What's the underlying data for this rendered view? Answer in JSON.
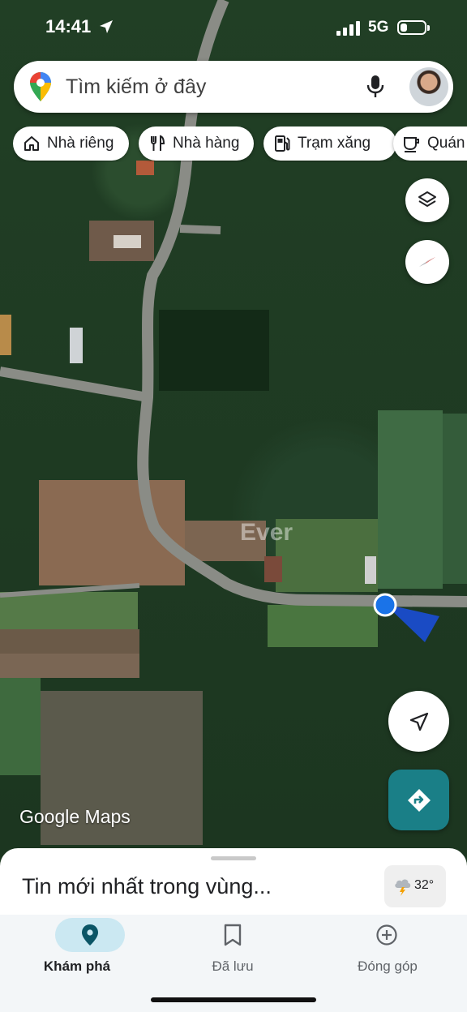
{
  "status_bar": {
    "time": "14:41",
    "network": "5G",
    "battery_level": 0.3
  },
  "search": {
    "placeholder": "Tìm kiếm ở đây"
  },
  "chips": [
    {
      "label": "Nhà riêng",
      "icon": "home-icon"
    },
    {
      "label": "Nhà hàng",
      "icon": "restaurant-icon"
    },
    {
      "label": "Trạm xăng",
      "icon": "gas-station-icon"
    },
    {
      "label": "Quán",
      "icon": "cafe-icon"
    }
  ],
  "map": {
    "logo": "Google Maps",
    "watermark": "Ever"
  },
  "sheet": {
    "title": "Tin mới nhất trong vùng...",
    "weather_temp": "32°"
  },
  "nav": [
    {
      "label": "Khám phá",
      "icon": "explore-pin-icon",
      "active": true
    },
    {
      "label": "Đã lưu",
      "icon": "bookmark-icon",
      "active": false
    },
    {
      "label": "Đóng góp",
      "icon": "add-circle-icon",
      "active": false
    }
  ],
  "colors": {
    "accent": "#1a7f87",
    "location_dot": "#1a73e8",
    "nav_active_pill": "#cbe8f2"
  }
}
